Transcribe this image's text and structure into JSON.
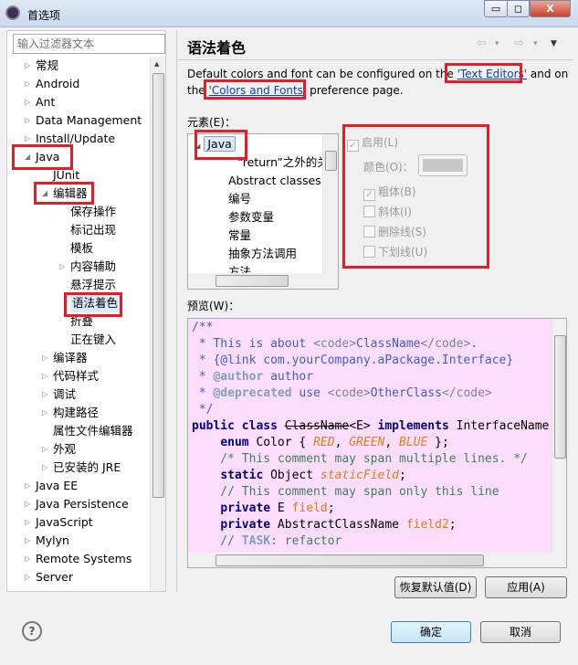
{
  "window": {
    "title": "首选项",
    "minimize": "▭",
    "maximize": "◻",
    "close": "X"
  },
  "filter": {
    "placeholder": "输入过滤器文本"
  },
  "tree": [
    {
      "label": "常规",
      "level": 0,
      "arrow": "▷"
    },
    {
      "label": "Android",
      "level": 0,
      "arrow": "▷"
    },
    {
      "label": "Ant",
      "level": 0,
      "arrow": "▷"
    },
    {
      "label": "Data Management",
      "level": 0,
      "arrow": "▷"
    },
    {
      "label": "Install/Update",
      "level": 0,
      "arrow": "▷"
    },
    {
      "label": "Java",
      "level": 0,
      "arrow": "◢"
    },
    {
      "label": "JUnit",
      "level": 1,
      "arrow": ""
    },
    {
      "label": "编辑器",
      "level": 1,
      "arrow": "◢"
    },
    {
      "label": "保存操作",
      "level": 2,
      "arrow": ""
    },
    {
      "label": "标记出现",
      "level": 2,
      "arrow": ""
    },
    {
      "label": "模板",
      "level": 2,
      "arrow": ""
    },
    {
      "label": "内容辅助",
      "level": 2,
      "arrow": "▷"
    },
    {
      "label": "悬浮提示",
      "level": 2,
      "arrow": ""
    },
    {
      "label": "语法着色",
      "level": 2,
      "arrow": "",
      "selected": true
    },
    {
      "label": "折叠",
      "level": 2,
      "arrow": ""
    },
    {
      "label": "正在键入",
      "level": 2,
      "arrow": ""
    },
    {
      "label": "编译器",
      "level": 1,
      "arrow": "▷"
    },
    {
      "label": "代码样式",
      "level": 1,
      "arrow": "▷"
    },
    {
      "label": "调试",
      "level": 1,
      "arrow": "▷"
    },
    {
      "label": "构建路径",
      "level": 1,
      "arrow": "▷"
    },
    {
      "label": "属性文件编辑器",
      "level": 1,
      "arrow": ""
    },
    {
      "label": "外观",
      "level": 1,
      "arrow": "▷"
    },
    {
      "label": "已安装的 JRE",
      "level": 1,
      "arrow": "▷"
    },
    {
      "label": "Java EE",
      "level": 0,
      "arrow": "▷"
    },
    {
      "label": "Java Persistence",
      "level": 0,
      "arrow": "▷"
    },
    {
      "label": "JavaScript",
      "level": 0,
      "arrow": "▷"
    },
    {
      "label": "Mylyn",
      "level": 0,
      "arrow": "▷"
    },
    {
      "label": "Remote Systems",
      "level": 0,
      "arrow": "▷"
    },
    {
      "label": "Server",
      "level": 0,
      "arrow": "▷"
    }
  ],
  "page": {
    "title": "语法着色",
    "desc_pre": "Default colors and font can be configured on the ",
    "link1": "'Text Editors'",
    "desc_mid": " and on the ",
    "link2": "'Colors and Fonts'",
    "desc_post": " preference page.",
    "nav": {
      "back": "⇦",
      "forward": "⇨",
      "dropdown": "▾",
      "menu": "▼"
    }
  },
  "elements": {
    "label": "元素(E)：",
    "root": "Java",
    "items": [
      "“return”之外的关",
      "Abstract classes",
      "编号",
      "参数变量",
      "常量",
      "抽象方法调用",
      "方法"
    ]
  },
  "options": {
    "enable": "启用(L)",
    "color": "颜色(O)：",
    "bold": "粗体(B)",
    "italic": "斜体(I)",
    "strike": "删除线(S)",
    "underline": "下划线(U)",
    "enable_checked": true,
    "bold_checked": true,
    "italic_checked": false,
    "strike_checked": false,
    "underline_checked": false
  },
  "preview": {
    "label": "预览(W)：",
    "lines": [
      [
        [
          "c-doc",
          "/**"
        ]
      ],
      [
        [
          "c-doc",
          " * This is about "
        ],
        [
          "c-tag",
          "<code>"
        ],
        [
          "c-doc",
          "ClassName"
        ],
        [
          "c-tag",
          "</code>"
        ],
        [
          "c-doc",
          "."
        ]
      ],
      [
        [
          "c-doc",
          " * {@link com.yourCompany.aPackage.Interface}"
        ]
      ],
      [
        [
          "c-doc",
          " * "
        ],
        [
          "c-dtag",
          "@author"
        ],
        [
          "c-doc",
          " author"
        ]
      ],
      [
        [
          "c-doc",
          " * "
        ],
        [
          "c-dtag",
          "@deprecated"
        ],
        [
          "c-doc",
          " use "
        ],
        [
          "c-tag",
          "<code>"
        ],
        [
          "c-doc",
          "OtherClass"
        ],
        [
          "c-tag",
          "</code>"
        ]
      ],
      [
        [
          "c-doc",
          " */"
        ]
      ],
      [
        [
          "c-kw",
          "public class "
        ],
        [
          "c-plain c-del",
          "ClassName"
        ],
        [
          "c-plain",
          "<E> "
        ],
        [
          "c-kw",
          "implements"
        ],
        [
          "c-plain",
          " InterfaceName"
        ]
      ],
      [
        [
          "c-plain",
          "    "
        ],
        [
          "c-kw",
          "enum"
        ],
        [
          "c-plain",
          " Color { "
        ],
        [
          "c-enum",
          "RED"
        ],
        [
          "c-plain",
          ", "
        ],
        [
          "c-enum",
          "GREEN"
        ],
        [
          "c-plain",
          ", "
        ],
        [
          "c-enum",
          "BLUE"
        ],
        [
          "c-plain",
          " };"
        ]
      ],
      [
        [
          "c-com",
          "    /* This comment may span multiple lines. */"
        ]
      ],
      [
        [
          "c-plain",
          "    "
        ],
        [
          "c-kw",
          "static"
        ],
        [
          "c-plain",
          " Object "
        ],
        [
          "c-sfld",
          "staticField"
        ],
        [
          "c-plain",
          ";"
        ]
      ],
      [
        [
          "c-com",
          "    // This comment may span only this line"
        ]
      ],
      [
        [
          "c-plain",
          "    "
        ],
        [
          "c-kw",
          "private"
        ],
        [
          "c-plain",
          " E "
        ],
        [
          "c-fld",
          "field"
        ],
        [
          "c-plain",
          ";"
        ]
      ],
      [
        [
          "c-plain",
          "    "
        ],
        [
          "c-kw",
          "private"
        ],
        [
          "c-plain",
          " AbstractClassName "
        ],
        [
          "c-fld",
          "field2"
        ],
        [
          "c-plain",
          ";"
        ]
      ],
      [
        [
          "c-com",
          "    // "
        ],
        [
          "c-task",
          "TASK"
        ],
        [
          "c-com",
          ": refactor"
        ]
      ]
    ]
  },
  "buttons": {
    "restore": "恢复默认值(D)",
    "apply": "应用(A)",
    "ok": "确定",
    "cancel": "取消",
    "help": "?"
  }
}
